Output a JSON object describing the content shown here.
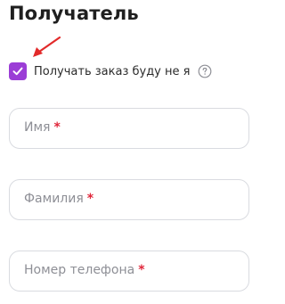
{
  "section": {
    "title": "Получатель"
  },
  "checkbox": {
    "label": "Получать заказ буду не я",
    "checked": true,
    "color": "#9b3dd6"
  },
  "help_icon": "question-circle-icon",
  "annotation": {
    "arrow_color": "#e22a2a"
  },
  "fields": [
    {
      "placeholder": "Имя",
      "required_mark": "*"
    },
    {
      "placeholder": "Фамилия",
      "required_mark": "*"
    },
    {
      "placeholder": "Номер телефона",
      "required_mark": "*"
    }
  ]
}
